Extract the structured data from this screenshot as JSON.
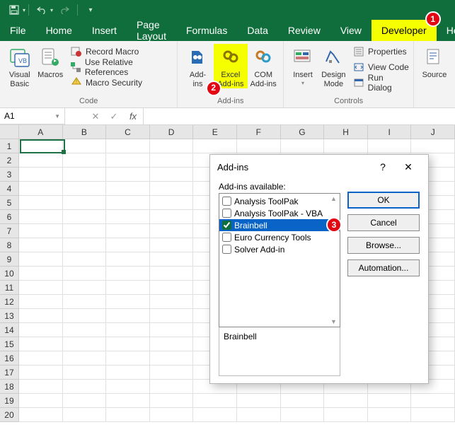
{
  "qat": {
    "save_icon": "save-icon",
    "undo_icon": "undo-icon",
    "redo_icon": "redo-icon",
    "customize_icon": "chevron-down-icon"
  },
  "tabs": [
    "File",
    "Home",
    "Insert",
    "Page Layout",
    "Formulas",
    "Data",
    "Review",
    "View",
    "Developer",
    "Help"
  ],
  "active_tab": "Developer",
  "ribbon": {
    "code_group": {
      "label": "Code",
      "visual_basic": "Visual\nBasic",
      "macros": "Macros",
      "record_macro": "Record Macro",
      "use_rel_ref": "Use Relative References",
      "macro_security": "Macro Security"
    },
    "addins_group": {
      "label": "Add-ins",
      "addins": "Add-\nins",
      "excel_addins": "Excel\nAdd-ins",
      "com_addins": "COM\nAdd-ins"
    },
    "controls_group": {
      "label": "Controls",
      "insert": "Insert",
      "design_mode": "Design\nMode",
      "properties": "Properties",
      "view_code": "View Code",
      "run_dialog": "Run Dialog",
      "source": "Source"
    }
  },
  "namebox": {
    "value": "A1"
  },
  "columns": [
    "A",
    "B",
    "C",
    "D",
    "E",
    "F",
    "G",
    "H",
    "I",
    "J"
  ],
  "rows": [
    "1",
    "2",
    "3",
    "4",
    "5",
    "6",
    "7",
    "8",
    "9",
    "10",
    "11",
    "12",
    "13",
    "14",
    "15",
    "16",
    "17",
    "18",
    "19",
    "20"
  ],
  "dialog": {
    "title": "Add-ins",
    "help": "?",
    "close": "✕",
    "avail_label": "Add-ins available:",
    "items": [
      {
        "label": "Analysis ToolPak",
        "checked": false,
        "selected": false
      },
      {
        "label": "Analysis ToolPak - VBA",
        "checked": false,
        "selected": false
      },
      {
        "label": "Brainbell",
        "checked": true,
        "selected": true
      },
      {
        "label": "Euro Currency Tools",
        "checked": false,
        "selected": false
      },
      {
        "label": "Solver Add-in",
        "checked": false,
        "selected": false
      }
    ],
    "desc": "Brainbell",
    "buttons": {
      "ok": "OK",
      "cancel": "Cancel",
      "browse": "Browse...",
      "automation": "Automation..."
    }
  },
  "callouts": {
    "c1": "1",
    "c2": "2",
    "c3": "3"
  }
}
